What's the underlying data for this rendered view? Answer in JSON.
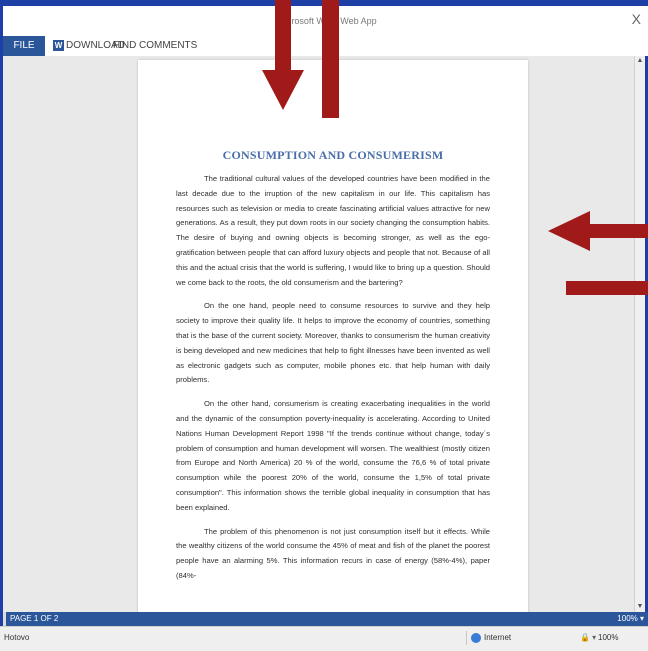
{
  "app": {
    "title": "Microsoft Word Web App",
    "close": "X"
  },
  "menu": {
    "file": "FILE",
    "download": "DOWNLOAD",
    "find": "FIND",
    "comments": "COMMENTS",
    "word_badge": "W"
  },
  "document": {
    "title": "CONSUMPTION AND CONSUMERISM",
    "paragraphs": [
      "The traditional cultural values of the developed countries have been modified in the last decade due to the irruption of the new capitalism in our life. This capitalism has resources such as television or media to create fascinating artificial values attractive for new generations. As a result, they put down roots in our society changing the consumption habits. The desire of buying and owning objects is becoming stronger, as well as the ego-gratification between people that can afford luxury objects and people that not. Because of all this and the actual crisis that the world is suffering, I would like to bring up a question. Should we come back to the roots, the old consumerism and the bartering?",
      "On the one hand, people need to consume resources to survive and they help society to improve their quality life. It helps to improve the economy of countries, something that is the base of the current society. Moreover, thanks to consumerism the human creativity is being developed and new medicines that help to fight illnesses have been invented as well as electronic gadgets such as computer, mobile phones etc. that help human with daily problems.",
      "On the other hand, consumerism is creating exacerbating inequalities in the world and the dynamic of the consumption poverty-inequality is accelerating. According to United Nations Human Development Report 1998 \"If the trends continue without change, today´s problem of consumption and human development will worsen. The wealthiest (mostly citizen from Europe and North America) 20 % of the world, consume the 76,6 % of total private consumption while the poorest 20% of the world,  consume the 1,5% of total private consumption\". This information shows the terrible global inequality in consumption that has been explained.",
      "The problem of this phenomenon is not just consumption itself but it effects. While the wealthy citizens of the world consume the 45% of meat and fish of the planet the poorest people have an alarming 5%. This information recurs in case of energy (58%-4%), paper (84%-"
    ]
  },
  "statusbar": {
    "page": "PAGE 1 OF 2",
    "zoom": "100% ▾"
  },
  "browser": {
    "status": "Hotovo",
    "zone": "Internet",
    "zoom": "100%",
    "security": "🔒 ▾"
  },
  "colors": {
    "accent": "#2b579a",
    "frame": "#1e3fa6",
    "title": "#4a6ea9",
    "arrow": "#a11a1a"
  }
}
